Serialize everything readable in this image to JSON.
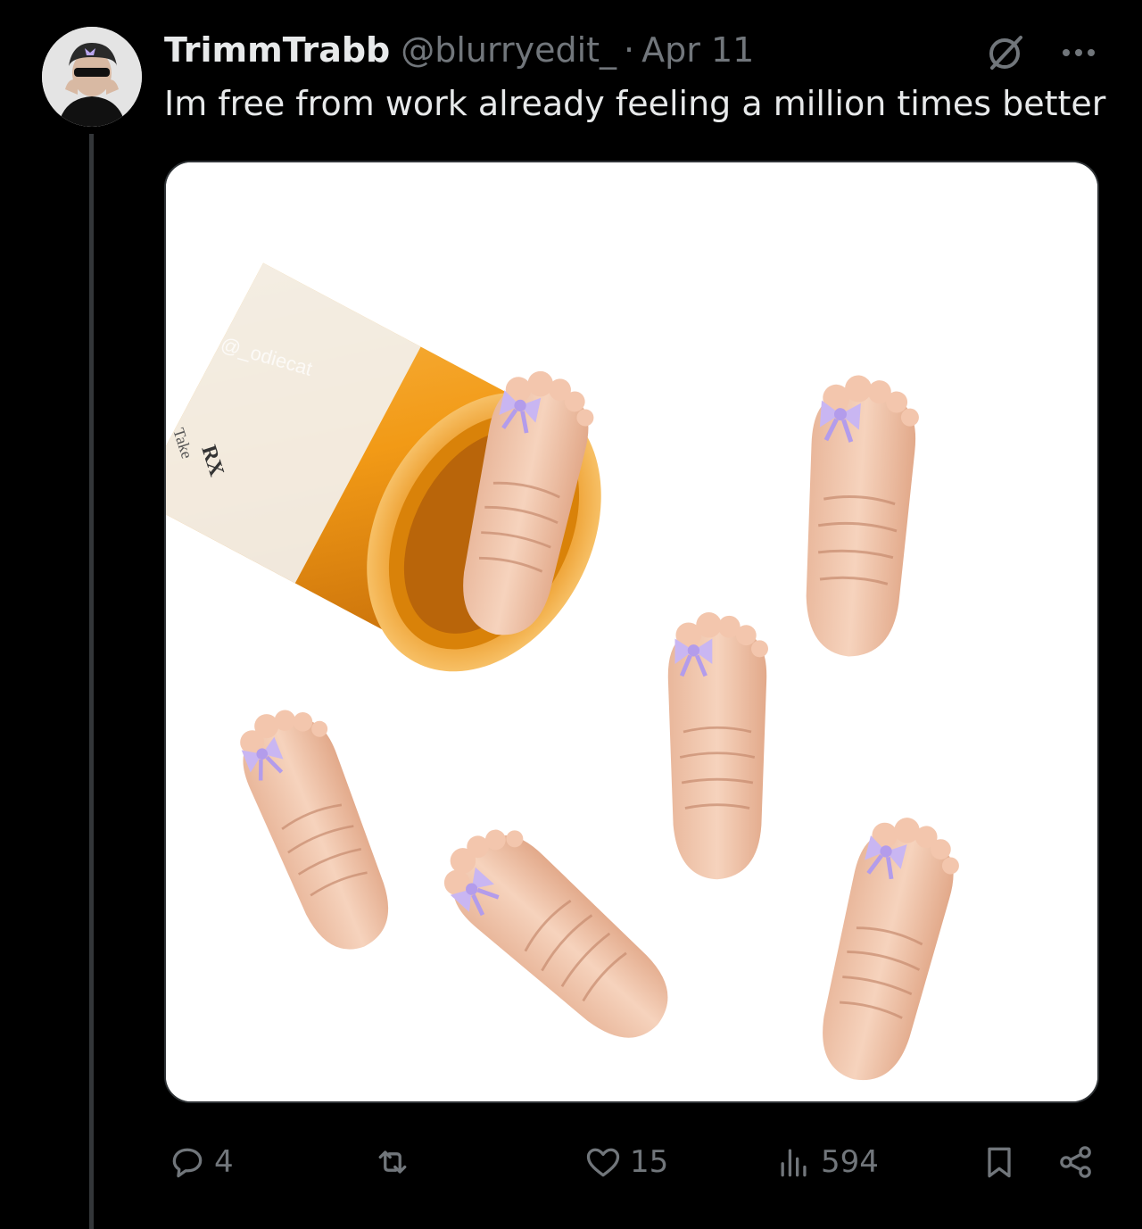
{
  "tweet": {
    "author": {
      "display_name": "TrimmTrabb",
      "handle": "@blurryedit_",
      "separator": "·",
      "date": "Apr 11"
    },
    "text": "Im free from work already feeling a million times better",
    "media": {
      "watermark": "@_odiecat",
      "label_text": "RX",
      "label_small": "Take"
    },
    "actions": {
      "replies": "4",
      "retweets": "",
      "likes": "15",
      "views": "594"
    }
  },
  "icons": {
    "reply": "reply-icon",
    "retweet": "retweet-icon",
    "like": "heart-icon",
    "views": "views-icon",
    "bookmark": "bookmark-icon",
    "share": "share-icon",
    "grok": "grok-icon",
    "more": "more-icon"
  },
  "colors": {
    "background": "#000000",
    "text_primary": "#e7e9ea",
    "text_secondary": "#71767b",
    "thread_line": "#333639",
    "bow": "#c9b6f2",
    "bottle": "#f29a16"
  }
}
